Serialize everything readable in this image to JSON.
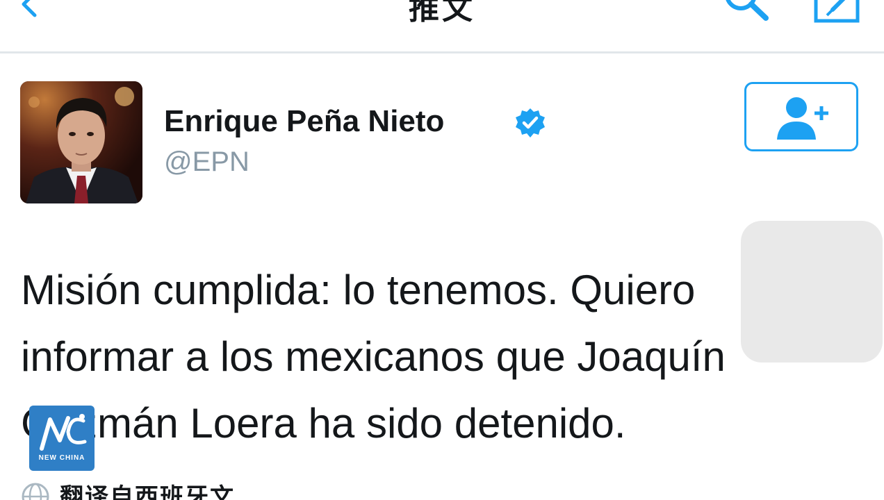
{
  "header": {
    "title": "推文",
    "back_icon": "chevron-left-icon",
    "search_icon": "search-icon",
    "compose_icon": "compose-icon",
    "accent_color": "#1da1f2"
  },
  "profile": {
    "display_name": "Enrique Peña Nieto",
    "handle": "@EPN",
    "verified": true,
    "verified_icon": "verified-badge-icon",
    "follow_icon": "add-user-icon"
  },
  "tweet": {
    "text": "Misión cumplida: lo tenemos. Quiero informar a los mexicanos que Joaquín Guzmán Loera ha sido detenido."
  },
  "translate": {
    "label": "翻译自西班牙文",
    "icon": "globe-icon"
  },
  "watermark": {
    "label": "NEW CHINA"
  }
}
